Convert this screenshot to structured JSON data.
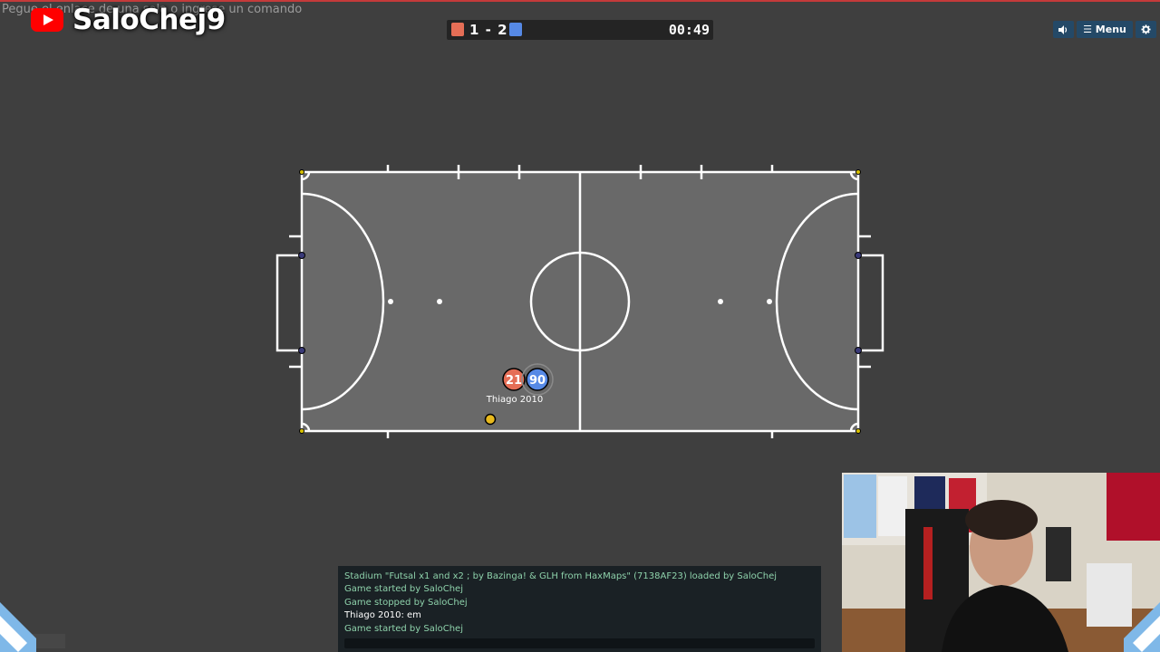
{
  "overlay": {
    "url_hint": "Pegue el enlace de una sala o ingrese un comando",
    "channel_name": "SaloChej9",
    "channel_icon": "youtube-logo-icon"
  },
  "scoreboard": {
    "red_score": "1",
    "separator": "-",
    "blue_score": "2",
    "timer": "00:49",
    "red_color": "#e56e56",
    "blue_color": "#5689e5"
  },
  "toolbar": {
    "sound_icon": "speaker-icon",
    "menu_label": "☰ Menu",
    "settings_icon": "gear-icon"
  },
  "game": {
    "players": [
      {
        "number": "21",
        "team": "red",
        "name": "Thiago 2010"
      },
      {
        "number": "90",
        "team": "blue",
        "name": ""
      }
    ],
    "ball_color": "#e8b91d",
    "field_color": "#6b6b6b",
    "line_color": "#ffffff"
  },
  "chat": {
    "messages": [
      {
        "type": "system",
        "text": "Stadium \"Futsal x1 and x2 ; by Bazinga! & GLH from HaxMaps\" (7138AF23) loaded by SaloChej"
      },
      {
        "type": "system",
        "text": "Game started by SaloChej"
      },
      {
        "type": "system",
        "text": "Game stopped by SaloChej"
      },
      {
        "type": "player",
        "text": "Thiago 2010: em"
      },
      {
        "type": "system",
        "text": "Game started by SaloChej"
      }
    ]
  }
}
